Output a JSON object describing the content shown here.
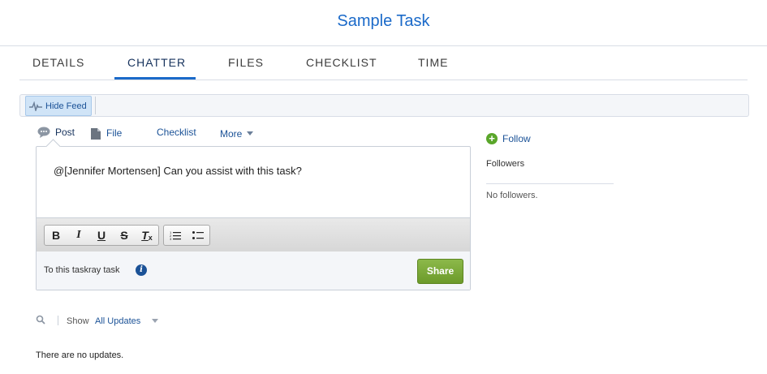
{
  "header": {
    "title": "Sample Task"
  },
  "tabs": [
    {
      "label": "DETAILS"
    },
    {
      "label": "CHATTER"
    },
    {
      "label": "FILES"
    },
    {
      "label": "CHECKLIST"
    },
    {
      "label": "TIME"
    }
  ],
  "active_tab": "CHATTER",
  "feed": {
    "hide_feed_label": "Hide Feed",
    "icon": "feed-pulse-icon"
  },
  "publisher": {
    "tabs": [
      {
        "label": "Post",
        "icon": "speech-bubble-icon"
      },
      {
        "label": "File",
        "icon": "file-icon"
      },
      {
        "label": "Checklist"
      },
      {
        "label": "More",
        "icon": "chevron-down-icon"
      }
    ],
    "post_text": "@[Jennifer Mortensen] Can you assist with this task?",
    "toolbar": {
      "bold": "B",
      "italic": "I",
      "underline": "U",
      "strike": "S",
      "clear_format": "T"
    },
    "to_text": "To this taskray task",
    "info_icon_glyph": "i",
    "share_label": "Share"
  },
  "sidebar": {
    "follow_label": "Follow",
    "followers_label": "Followers",
    "no_followers": "No followers."
  },
  "filter": {
    "show_label": "Show",
    "show_value": "All Updates"
  },
  "empty_state": "There are no updates.",
  "colors": {
    "brand_blue": "#1b6ac9",
    "link_blue": "#1b5297",
    "share_green": "#7aaa35",
    "follow_green": "#5aa62a"
  }
}
